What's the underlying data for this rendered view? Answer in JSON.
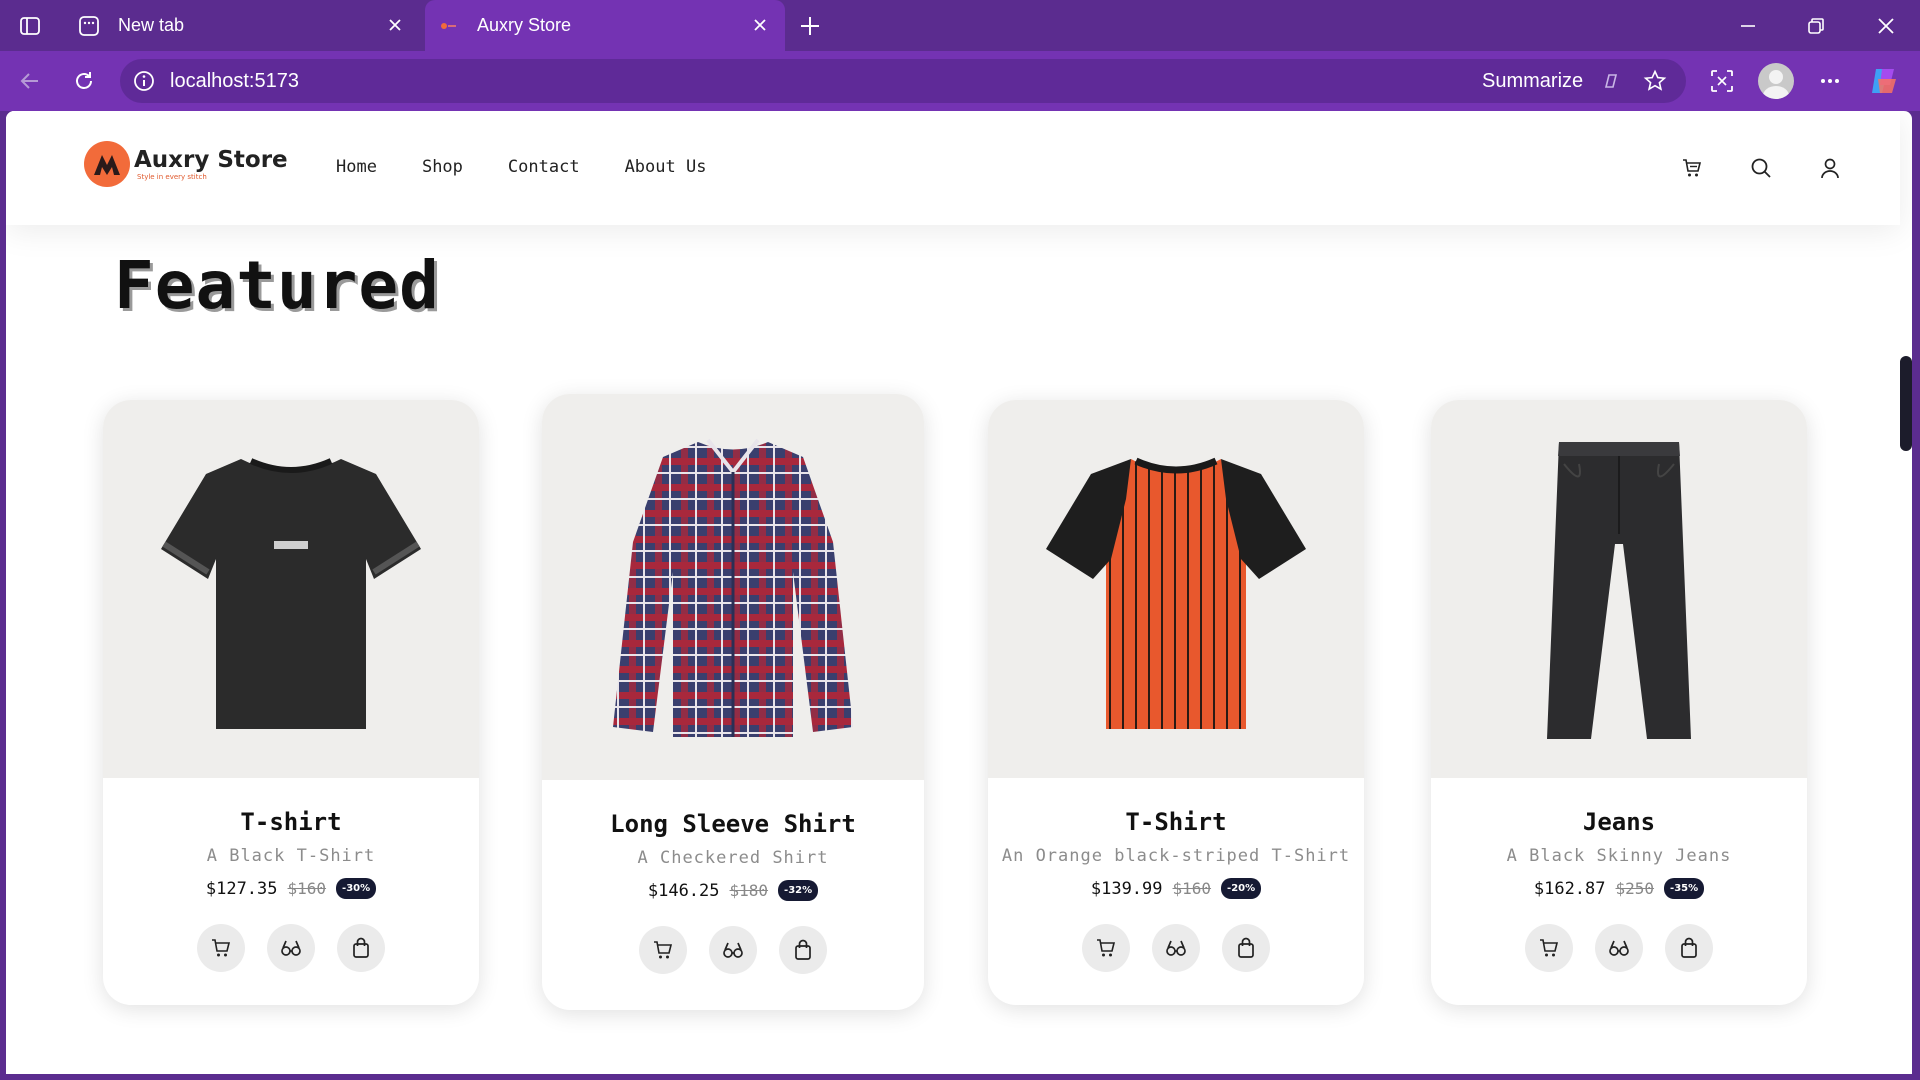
{
  "browser": {
    "tabs": [
      {
        "label": "New tab"
      },
      {
        "label": "Auxry Store"
      }
    ],
    "address": "localhost:5173",
    "summarize_label": "Summarize"
  },
  "site": {
    "brand": {
      "name": "Auxry Store",
      "tagline": "Style in every stitch"
    },
    "nav": [
      {
        "label": "Home"
      },
      {
        "label": "Shop"
      },
      {
        "label": "Contact"
      },
      {
        "label": "About Us"
      }
    ],
    "icons": [
      "cart-icon",
      "search-icon",
      "user-icon"
    ]
  },
  "featured": {
    "title": "Featured",
    "products": [
      {
        "name": "T-shirt",
        "description": "A Black T-Shirt",
        "price": "$127.35",
        "old_price": "$160",
        "discount": "-30%",
        "image": "black-tshirt"
      },
      {
        "name": "Long Sleeve Shirt",
        "description": "A Checkered Shirt",
        "price": "$146.25",
        "old_price": "$180",
        "discount": "-32%",
        "image": "checkered-shirt"
      },
      {
        "name": "T-Shirt",
        "description": "An Orange black-striped T-Shirt",
        "price": "$139.99",
        "old_price": "$160",
        "discount": "-20%",
        "image": "orange-striped-tshirt"
      },
      {
        "name": "Jeans",
        "description": "A Black Skinny Jeans",
        "price": "$162.87",
        "old_price": "$250",
        "discount": "-35%",
        "image": "black-jeans"
      }
    ],
    "action_icons": [
      "add-to-cart-icon",
      "quick-view-icon",
      "buy-now-icon"
    ]
  },
  "colors": {
    "chrome": "#5b2c8f",
    "chrome_active": "#7433b3",
    "brand_orange": "#f26b3a",
    "badge": "#161a33"
  }
}
